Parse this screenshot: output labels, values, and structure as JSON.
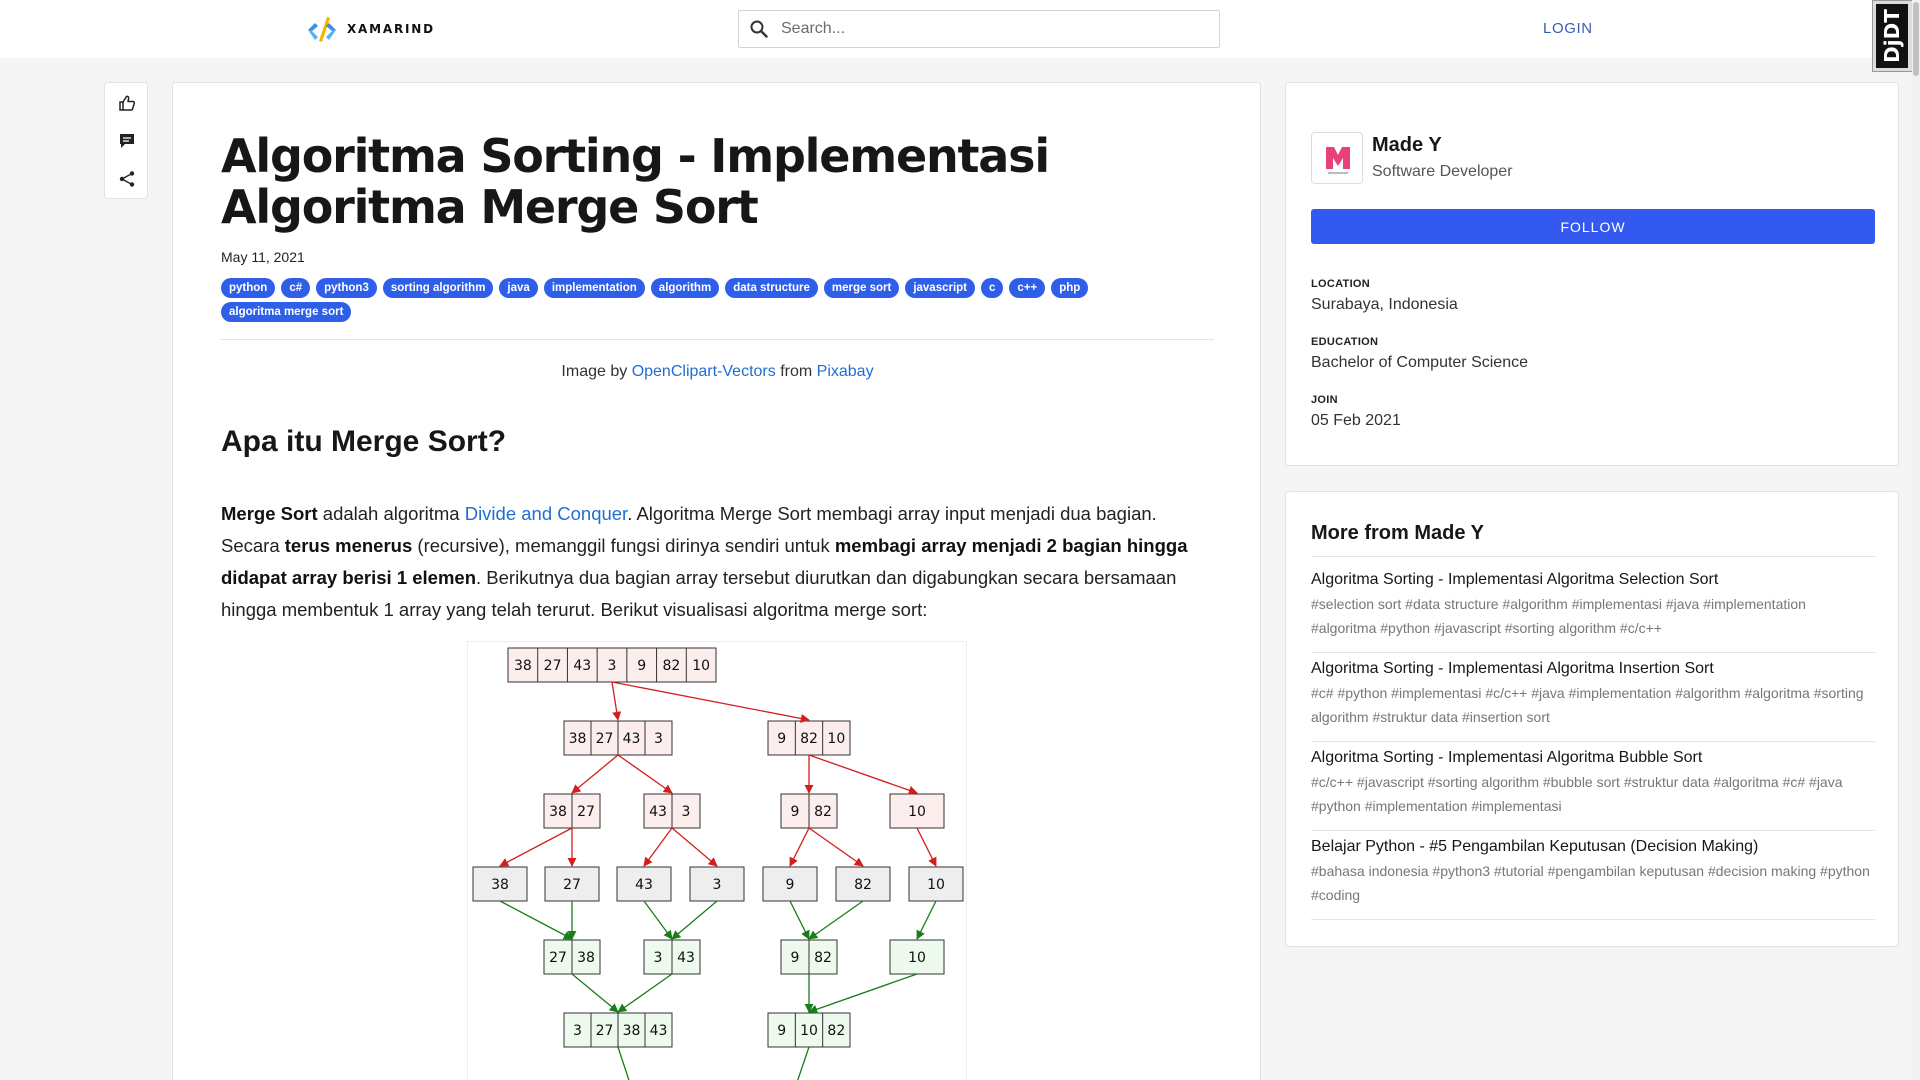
{
  "header": {
    "logo_text": "XAMARIND",
    "search_placeholder": "Search...",
    "login_label": "LOGIN",
    "debug_toolbar_label": "DjDT"
  },
  "article": {
    "title": "Algoritma Sorting - Implementasi Algoritma Merge Sort",
    "date": "May 11, 2021",
    "tags": [
      "python",
      "c#",
      "python3",
      "sorting algorithm",
      "java",
      "implementation",
      "algorithm",
      "data structure",
      "merge sort",
      "javascript",
      "c",
      "c++",
      "php",
      "algoritma merge sort"
    ],
    "image_credit": {
      "prefix": "Image by",
      "author": "OpenClipart-Vectors",
      "middle": "from",
      "source": "Pixabay"
    },
    "heading": "Apa itu Merge Sort?",
    "paragraph": {
      "p1_bold": "Merge Sort",
      "p2": " adalah algoritma ",
      "p3_link": "Divide and Conquer",
      "p4": ". Algoritma Merge Sort membagi array input menjadi dua bagian. Secara ",
      "p5_bold": "terus menerus",
      "p6": " (recursive), memanggil fungsi dirinya sendiri untuk ",
      "p7_bold": "membagi array menjadi 2 bagian hingga didapat array berisi 1 elemen",
      "p8": ". Berikutnya dua bagian array tersebut diurutkan dan digabungkan secara bersamaan hingga membentuk 1 array yang telah terurut. Berikut visualisasi algoritma merge sort:"
    }
  },
  "diagram": {
    "colors": {
      "split_fill": "#fdeeee",
      "split_arrow": "#d41e1e",
      "single_fill": "#eeeeee",
      "merge_fill": "#eefaee",
      "merge_arrow": "#1a7d1a",
      "border": "#333333"
    },
    "rows": [
      {
        "kind": "split",
        "groups": [
          [
            "38",
            "27",
            "43",
            "3",
            "9",
            "82",
            "10"
          ]
        ]
      },
      {
        "kind": "split",
        "groups": [
          [
            "38",
            "27",
            "43",
            "3"
          ],
          [
            "9",
            "82",
            "10"
          ]
        ]
      },
      {
        "kind": "split",
        "groups": [
          [
            "38",
            "27"
          ],
          [
            "43",
            "3"
          ],
          [
            "9",
            "82"
          ],
          [
            "10"
          ]
        ]
      },
      {
        "kind": "single",
        "groups": [
          [
            "38"
          ],
          [
            "27"
          ],
          [
            "43"
          ],
          [
            "3"
          ],
          [
            "9"
          ],
          [
            "82"
          ],
          [
            "10"
          ]
        ]
      },
      {
        "kind": "merge",
        "groups": [
          [
            "27",
            "38"
          ],
          [
            "3",
            "43"
          ],
          [
            "9",
            "82"
          ],
          [
            "10"
          ]
        ]
      },
      {
        "kind": "merge",
        "groups": [
          [
            "3",
            "27",
            "38",
            "43"
          ],
          [
            "9",
            "10",
            "82"
          ]
        ]
      }
    ]
  },
  "profile": {
    "name": "Made Y",
    "role": "Software Developer",
    "follow_label": "FOLLOW",
    "location_label": "LOCATION",
    "location": "Surabaya, Indonesia",
    "education_label": "EDUCATION",
    "education": "Bachelor of Computer Science",
    "join_label": "JOIN",
    "join": "05 Feb 2021"
  },
  "more": {
    "title": "More from Made Y",
    "items": [
      {
        "title": "Algoritma Sorting - Implementasi Algoritma Selection Sort",
        "tags": "#selection sort #data structure #algorithm #implementasi #java #implementation #algoritma #python #javascript #sorting algorithm #c/c++"
      },
      {
        "title": "Algoritma Sorting - Implementasi Algoritma Insertion Sort",
        "tags": "#c# #python #implementasi #c/c++ #java #implementation #algorithm #algoritma #sorting algorithm #struktur data #insertion sort"
      },
      {
        "title": "Algoritma Sorting - Implementasi Algoritma Bubble Sort",
        "tags": "#c/c++ #javascript #sorting algorithm #bubble sort #struktur data #algoritma #c# #java #python #implementation #implementasi"
      },
      {
        "title": "Belajar Python - #5 Pengambilan Keputusan (Decision Making)",
        "tags": "#bahasa indonesia #python3 #tutorial #pengambilan keputusan #decision making #python #coding"
      }
    ]
  }
}
